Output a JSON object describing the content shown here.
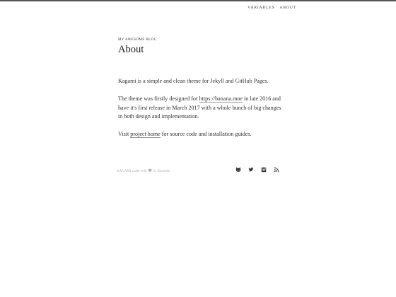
{
  "nav": {
    "items": [
      {
        "label": "VARIABLES"
      },
      {
        "label": "ABOUT"
      }
    ]
  },
  "header": {
    "blog_name": "MY AWESOME BLOG",
    "page_title": "About"
  },
  "content": {
    "para1": "Kagami is a simple and clean theme for Jekyll and GitHub Pages.",
    "para2_before": "The theme was firstly designed for ",
    "para2_link": "https://banana.moe",
    "para2_after": " in late 2016 and have it's first release in March 2017 with a whole bunch of big changes in both design and implementation.",
    "para3_before": "Visit ",
    "para3_link": "project home",
    "para3_after": " for source code and installation guides."
  },
  "footer": {
    "credit_before": "KAGAMI made with ",
    "credit_after": " by Kameshi",
    "icons": [
      "github-icon",
      "twitter-icon",
      "instagram-icon",
      "rss-icon"
    ]
  },
  "colors": {
    "text": "#333333",
    "muted": "#b0b0b0",
    "top_rule": "#555555",
    "background": "#ffffff"
  }
}
